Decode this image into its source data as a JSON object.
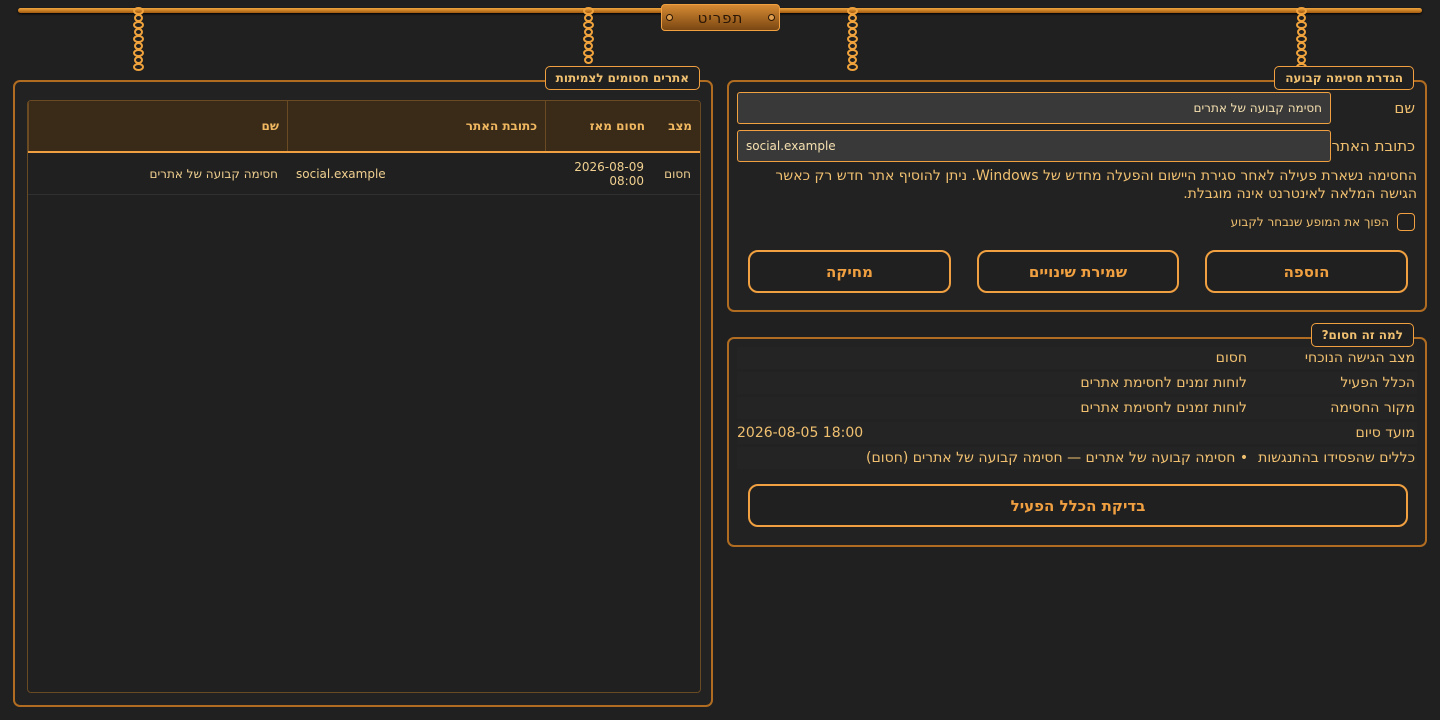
{
  "app": {
    "menu_label": "תפריט"
  },
  "blocked_sites": {
    "title": "אתרים חסומים לצמיתות",
    "columns": {
      "name": "שם",
      "url": "כתובת האתר",
      "since": "חסום מאז",
      "state": "מצב"
    },
    "rows": [
      {
        "name": "חסימה קבועה של אתרים",
        "url": "social.example",
        "since": "2026-08-09 08:00",
        "state": "חסום"
      }
    ]
  },
  "permanent_block": {
    "title": "הגדרת חסימה קבועה",
    "name_label": "שם",
    "name_value": "חסימה קבועה של אתרים",
    "url_label": "כתובת האתר",
    "url_value": "social.example",
    "notice": "החסימה נשארת פעילה לאחר סגירת היישום והפעלה מחדש של Windows. ניתן להוסיף אתר חדש רק כאשר הגישה המלאה לאינטרנט אינה מוגבלת.",
    "checkbox_label": "הפוך את המופע שנבחר לקבוע",
    "checkbox_checked": false,
    "add_button": "הוספה",
    "save_button": "שמירת שינויים",
    "delete_button": "מחיקה"
  },
  "why_blocked": {
    "title": "למה זה חסום?",
    "rows": [
      {
        "key": "מצב הגישה הנוכחי",
        "value": "חסום"
      },
      {
        "key": "הכלל הפעיל",
        "value": "לוחות זמנים לחסימת אתרים"
      },
      {
        "key": "מקור החסימה",
        "value": "לוחות זמנים לחסימת אתרים"
      },
      {
        "key": "מועד סיום",
        "value": "2026-08-05 18:00"
      },
      {
        "key": "כללים שהפסידו בהתנגשות",
        "value": "• חסימה קבועה של אתרים — חסימה קבועה של אתרים (חסום)"
      }
    ],
    "check_button": "בדיקת הכלל הפעיל"
  },
  "colors": {
    "accent": "#f0a040",
    "background": "#202020",
    "text": "#f0c070"
  }
}
